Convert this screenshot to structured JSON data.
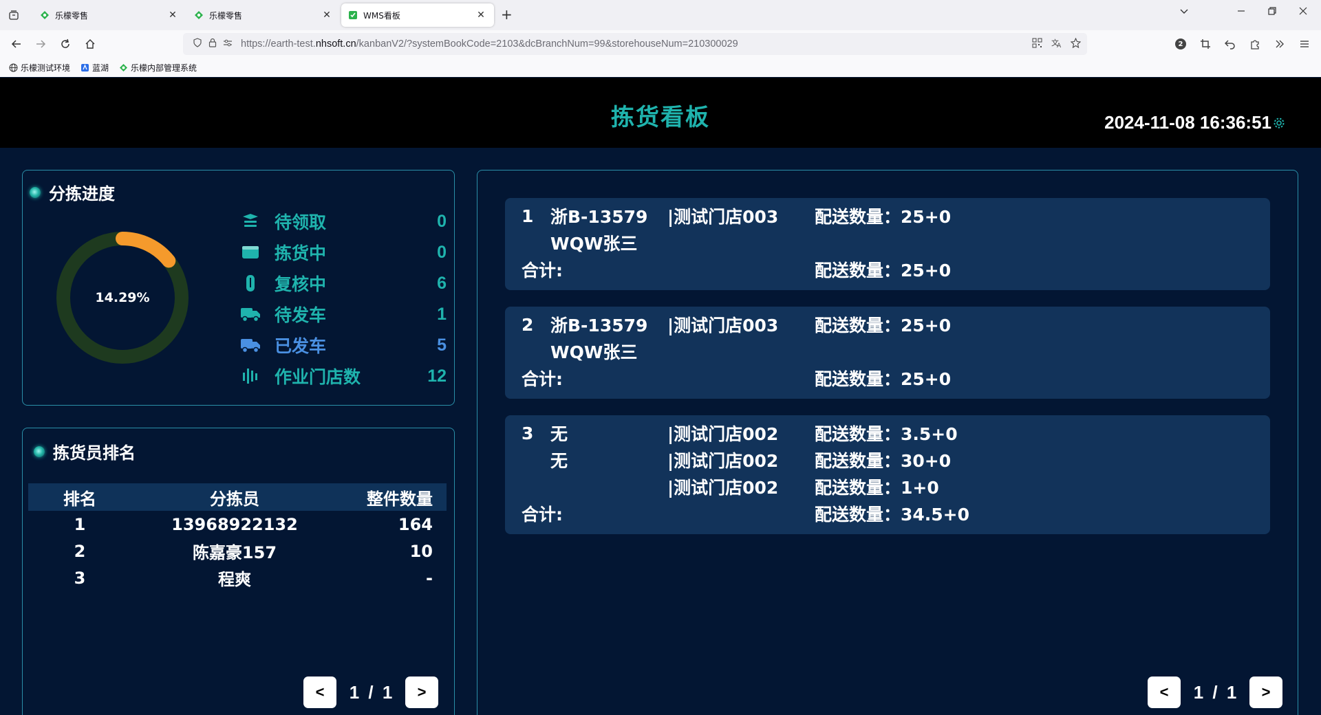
{
  "browser": {
    "tabs": [
      {
        "title": "乐檬零售",
        "active": false
      },
      {
        "title": "乐檬零售",
        "active": false
      },
      {
        "title": "WMS看板",
        "active": true
      }
    ],
    "url_prefix": "https://earth-test.",
    "url_host": "nhsoft.cn",
    "url_suffix": "/kanbanV2/?systemBookCode=2103&dcBranchNum=99&storehouseNum=210300029",
    "extension_badge": "2",
    "bookmarks": [
      {
        "label": "乐檬测试环境",
        "icon": "globe-icon"
      },
      {
        "label": "蓝湖",
        "icon": "lanhu-icon"
      },
      {
        "label": "乐檬内部管理系统",
        "icon": "lemeng-icon"
      }
    ]
  },
  "header": {
    "title": "拣货看板",
    "datetime": "2024-11-08 16:36:51"
  },
  "progress": {
    "title": "分拣进度",
    "percent_label": "14.29%",
    "percent_value": 14.29,
    "ring_color": "#1e3a1f",
    "arc_color": "#f59a2c",
    "stats": [
      {
        "label": "待领取",
        "value": "0",
        "icon": "receive-icon",
        "color": "#1fb3ad"
      },
      {
        "label": "拣货中",
        "value": "0",
        "icon": "picking-icon",
        "color": "#1fb3ad"
      },
      {
        "label": "复核中",
        "value": "6",
        "icon": "review-icon",
        "color": "#1fb3ad"
      },
      {
        "label": "待发车",
        "value": "1",
        "icon": "truck-icon",
        "color": "#1fb3ad"
      },
      {
        "label": "已发车",
        "value": "5",
        "icon": "truck-departed-icon",
        "color": "#4a90e2"
      },
      {
        "label": "作业门店数",
        "value": "12",
        "icon": "stores-icon",
        "color": "#1fb3ad"
      }
    ]
  },
  "ranking": {
    "title": "拣货员排名",
    "columns": [
      "排名",
      "分拣员",
      "整件数量"
    ],
    "rows": [
      {
        "rank": "1",
        "name": "13968922132",
        "qty": "164"
      },
      {
        "rank": "2",
        "name": "陈嘉豪157",
        "qty": "10"
      },
      {
        "rank": "3",
        "name": "程爽",
        "qty": "-"
      }
    ],
    "pager": {
      "prev": "<",
      "page": "1 / 1",
      "next": ">"
    }
  },
  "orders": {
    "cards": [
      {
        "index": "1",
        "lines": [
          {
            "plate": "浙B-13579",
            "store": "|测试门店003",
            "qty": "配送数量：25+0"
          },
          {
            "plate": "WQW张三",
            "store": "",
            "qty": ""
          }
        ],
        "total_label": "合计:",
        "total_qty": "配送数量：25+0"
      },
      {
        "index": "2",
        "lines": [
          {
            "plate": "浙B-13579",
            "store": "|测试门店003",
            "qty": "配送数量：25+0"
          },
          {
            "plate": "WQW张三",
            "store": "",
            "qty": ""
          }
        ],
        "total_label": "合计:",
        "total_qty": "配送数量：25+0"
      },
      {
        "index": "3",
        "lines": [
          {
            "plate": "无",
            "store": "|测试门店002",
            "qty": "配送数量：3.5+0"
          },
          {
            "plate": "无",
            "store": "|测试门店002",
            "qty": "配送数量：30+0"
          },
          {
            "plate": "",
            "store": "|测试门店002",
            "qty": "配送数量：1+0"
          }
        ],
        "total_label": "合计:",
        "total_qty": "配送数量：34.5+0"
      }
    ],
    "pager": {
      "prev": "<",
      "page": "1 / 1",
      "next": ">"
    }
  }
}
